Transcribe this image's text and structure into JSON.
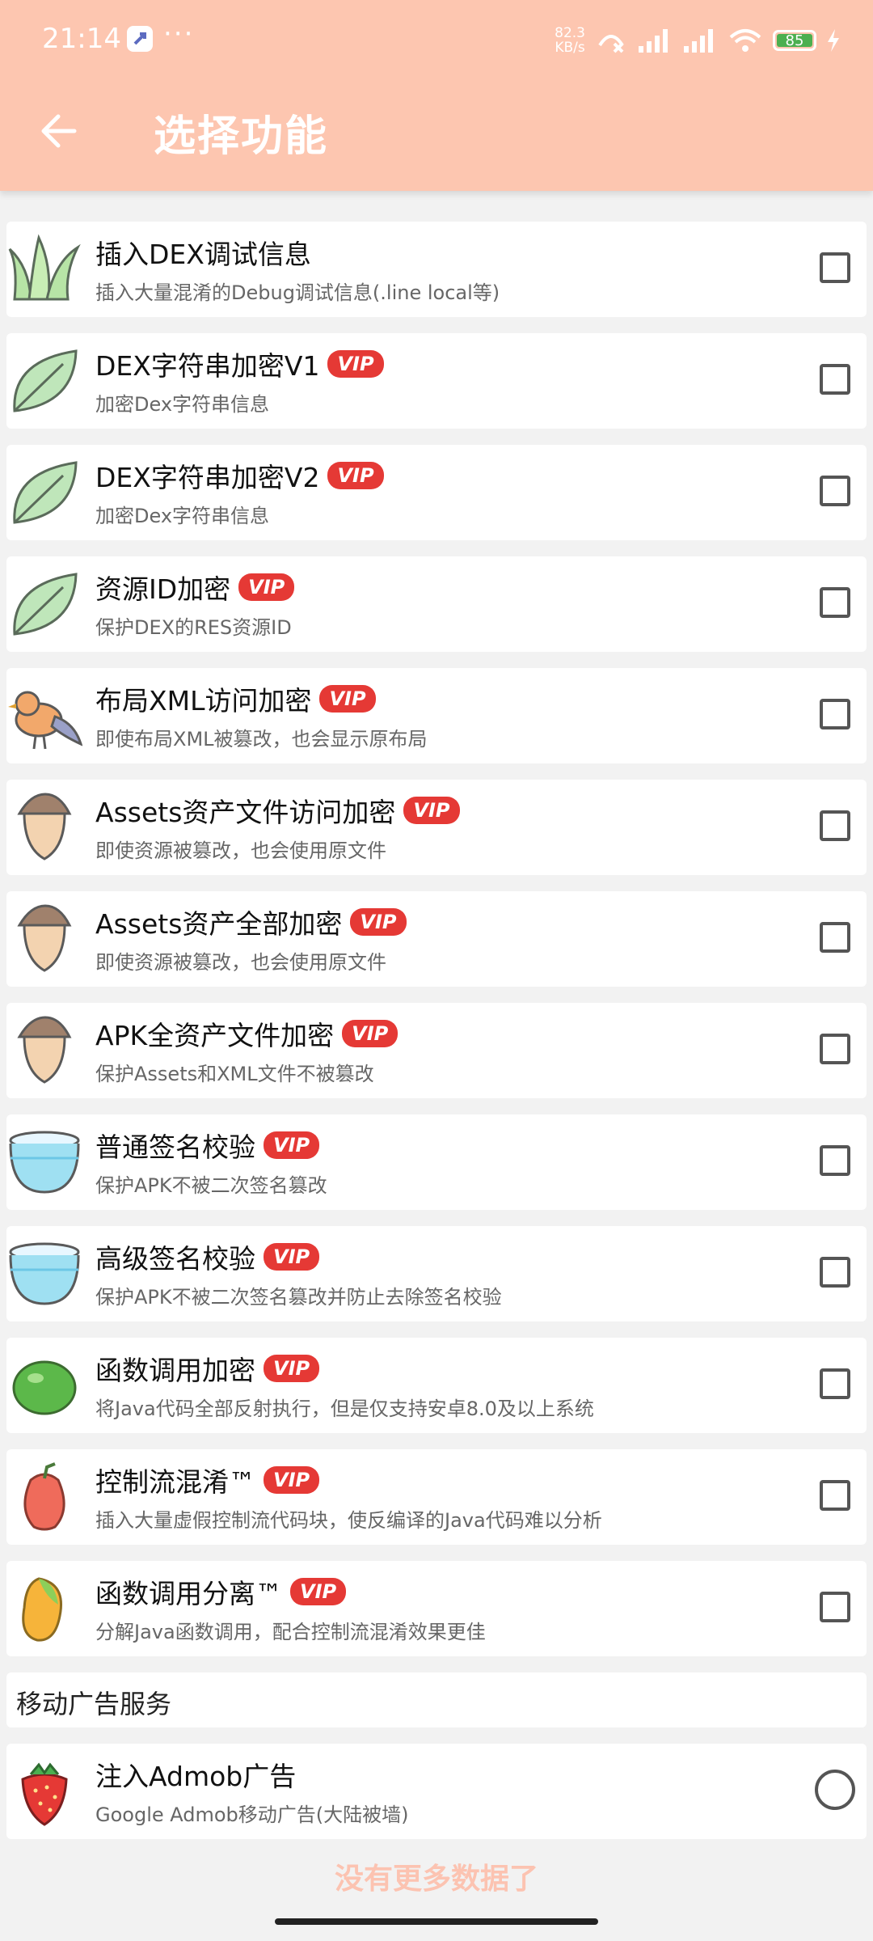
{
  "status": {
    "time": "21:14",
    "dots": "···",
    "speed_value": "82.3",
    "speed_unit": "KB/s",
    "battery": "85"
  },
  "header": {
    "title": "选择功能"
  },
  "items": [
    {
      "title": "插入DEX调试信息",
      "vip": "",
      "desc": "插入大量混淆的Debug调试信息(.line local等)",
      "icon": "grass-icon"
    },
    {
      "title": "DEX字符串加密V1",
      "vip": "VIP",
      "desc": "加密Dex字符串信息",
      "icon": "leaf-icon"
    },
    {
      "title": "DEX字符串加密V2",
      "vip": "VIP",
      "desc": "加密Dex字符串信息",
      "icon": "leaf-icon"
    },
    {
      "title": "资源ID加密",
      "vip": "VIP",
      "desc": "保护DEX的RES资源ID",
      "icon": "leaf-icon"
    },
    {
      "title": "布局XML访问加密",
      "vip": "VIP",
      "desc": "即使布局XML被篡改，也会显示原布局",
      "icon": "bird-icon"
    },
    {
      "title": "Assets资产文件访问加密",
      "vip": "VIP",
      "desc": "即使资源被篡改，也会使用原文件",
      "icon": "acorn-icon"
    },
    {
      "title": "Assets资产全部加密",
      "vip": "VIP",
      "desc": "即使资源被篡改，也会使用原文件",
      "icon": "acorn-icon"
    },
    {
      "title": "APK全资产文件加密",
      "vip": "VIP",
      "desc": "保护Assets和XML文件不被篡改",
      "icon": "acorn-icon"
    },
    {
      "title": "普通签名校验",
      "vip": "VIP",
      "desc": "保护APK不被二次签名篡改",
      "icon": "bowl-icon"
    },
    {
      "title": "高级签名校验",
      "vip": "VIP",
      "desc": "保护APK不被二次签名篡改并防止去除签名校验",
      "icon": "bowl-icon"
    },
    {
      "title": "函数调用加密",
      "vip": "VIP",
      "desc": "将Java代码全部反射执行，但是仅支持安卓8.0及以上系统",
      "icon": "lime-icon"
    },
    {
      "title": "控制流混淆™",
      "vip": "VIP",
      "desc": "插入大量虚假控制流代码块，使反编译的Java代码难以分析",
      "icon": "rose-apple-icon"
    },
    {
      "title": "函数调用分离™",
      "vip": "VIP",
      "desc": "分解Java函数调用，配合控制流混淆效果更佳",
      "icon": "mango-icon"
    }
  ],
  "section": {
    "label": "移动广告服务"
  },
  "ad_item": {
    "title": "注入Admob广告",
    "desc": "Google Admob移动广告(大陆被墙)",
    "icon": "strawberry-icon"
  },
  "footer": {
    "no_more": "没有更多数据了"
  },
  "colors": {
    "header": "#fdc6b0",
    "vip": "#e53935",
    "footer_text": "#fcc3b1"
  }
}
